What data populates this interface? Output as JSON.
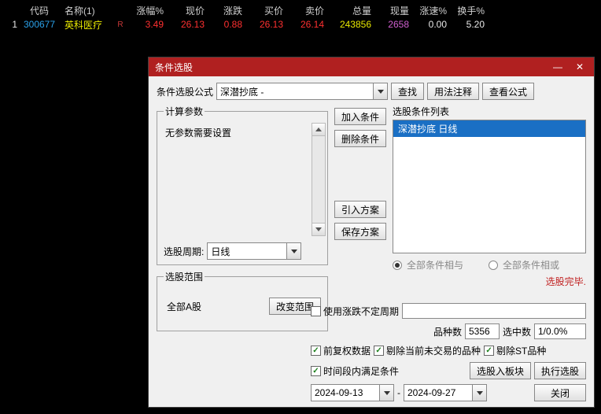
{
  "table": {
    "headers": {
      "code": "代码",
      "name": "名称(1)",
      "pct": "涨幅%",
      "price": "现价",
      "chg": "涨跌",
      "bid": "买价",
      "ask": "卖价",
      "vol": "总量",
      "now": "现量",
      "spd": "涨速%",
      "turn": "换手%"
    },
    "row": {
      "idx": "1",
      "code": "300677",
      "name": "英科医疗",
      "rflag": "R",
      "pct": "3.49",
      "price": "26.13",
      "chg": "0.88",
      "bid": "26.13",
      "ask": "26.14",
      "vol": "243856",
      "now": "2658",
      "spd": "0.00",
      "turn": "5.20"
    }
  },
  "dialog": {
    "title": "条件选股",
    "formula_label": "条件选股公式",
    "formula_value": "深潜抄底    -",
    "btn_find": "查找",
    "btn_usage": "用法注释",
    "btn_view_formula": "查看公式",
    "calc_params_legend": "计算参数",
    "no_params_text": "无参数需要设置",
    "period_label": "选股周期:",
    "period_value": "日线",
    "range_legend": "选股范围",
    "range_value": "全部A股",
    "btn_change_range": "改变范围",
    "btn_add_cond": "加入条件",
    "btn_del_cond": "删除条件",
    "btn_import": "引入方案",
    "btn_save": "保存方案",
    "cond_list_label": "选股条件列表",
    "cond_item": "深潜抄底  日线",
    "radio_and": "全部条件相与",
    "radio_or": "全部条件相或",
    "sel_done": "选股完毕.",
    "chk_use_period": "使用涨跌不定周期",
    "variety_label": "品种数",
    "variety_value": "5356",
    "hit_label": "选中数",
    "hit_value": "1/0.0%",
    "chk_fq": "前复权数据",
    "chk_exclude_no_trade": "剔除当前未交易的品种",
    "chk_exclude_st": "剔除ST品种",
    "chk_time_range": "时间段内满足条件",
    "btn_to_block": "选股入板块",
    "btn_execute": "执行选股",
    "date_from": "2024-09-13",
    "date_sep": "-",
    "date_to": "2024-09-27",
    "btn_close": "关闭"
  }
}
